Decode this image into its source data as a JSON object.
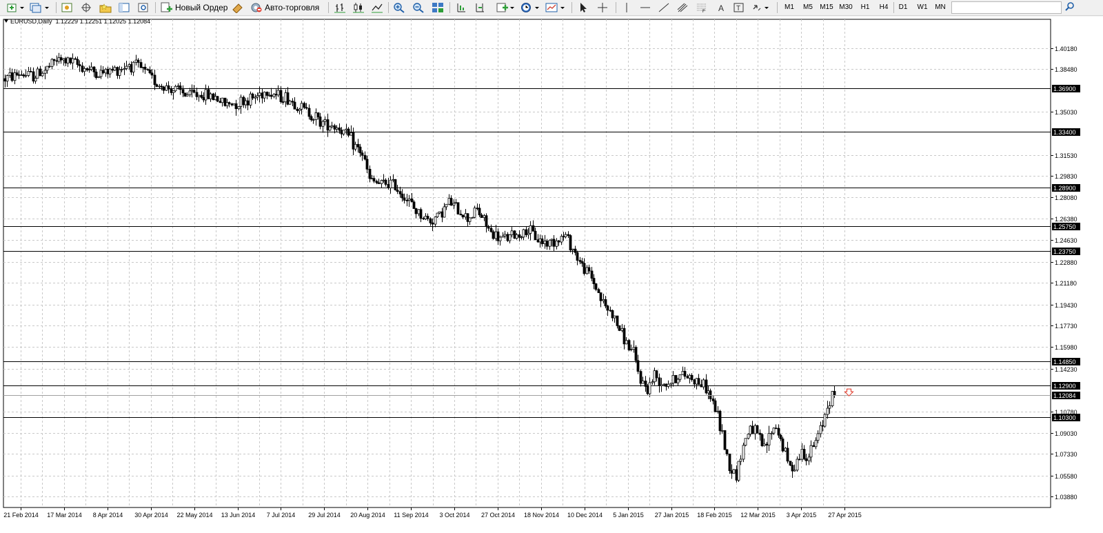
{
  "toolbar": {
    "new_order_label": "Новый Ордер",
    "auto_trading_label": "Авто-торговля",
    "timeframes": [
      "M1",
      "M5",
      "M15",
      "M30",
      "H1",
      "H4",
      "D1",
      "W1",
      "MN"
    ],
    "search_placeholder": ""
  },
  "chart_header": {
    "symbol": "EURUSD,Daily",
    "ohlc": "1.12229 1.12251 1.12025 1.12084"
  },
  "chart_data": {
    "type": "candlestick",
    "symbol": "EURUSD",
    "timeframe": "Daily",
    "ylim": [
      1.03,
      1.425
    ],
    "price_ticks": [
      1.4018,
      1.3848,
      1.3503,
      1.3153,
      1.2983,
      1.2808,
      1.2638,
      1.2463,
      1.2288,
      1.2118,
      1.1943,
      1.1773,
      1.1598,
      1.1423,
      1.1078,
      1.0903,
      1.0733,
      1.0558,
      1.0388
    ],
    "price_tick_labels": [
      "1.40180",
      "1.38480",
      "1.35030",
      "1.31530",
      "1.29830",
      "1.28080",
      "1.26380",
      "1.24630",
      "1.22880",
      "1.21180",
      "1.19430",
      "1.17730",
      "1.15980",
      "1.14230",
      "1.10780",
      "1.09030",
      "1.07330",
      "1.05580",
      "1.03880"
    ],
    "date_labels": [
      "21 Feb 2014",
      "17 Mar 2014",
      "8 Apr 2014",
      "30 Apr 2014",
      "22 May 2014",
      "13 Jun 2014",
      "7 Jul 2014",
      "29 Jul 2014",
      "20 Aug 2014",
      "11 Sep 2014",
      "3 Oct 2014",
      "27 Oct 2014",
      "18 Nov 2014",
      "10 Dec 2014",
      "5 Jan 2015",
      "27 Jan 2015",
      "18 Feb 2015",
      "12 Mar 2015",
      "3 Apr 2015",
      "27 Apr 2015"
    ],
    "horizontal_levels": [
      1.369,
      1.334,
      1.289,
      1.2575,
      1.2375,
      1.1485,
      1.129,
      1.103
    ],
    "horizontal_level_labels": [
      "1.36900",
      "1.33400",
      "1.28900",
      "1.25750",
      "1.23750",
      "1.14850",
      "1.12900",
      "1.10300"
    ],
    "current_price": 1.12084,
    "current_price_label": "1.12084",
    "price_path": [
      [
        0,
        1.377
      ],
      [
        6,
        1.381
      ],
      [
        12,
        1.379
      ],
      [
        18,
        1.385
      ],
      [
        22,
        1.392
      ],
      [
        27,
        1.391
      ],
      [
        30,
        1.389
      ],
      [
        35,
        1.385
      ],
      [
        40,
        1.381
      ],
      [
        45,
        1.383
      ],
      [
        50,
        1.386
      ],
      [
        53,
        1.389
      ],
      [
        57,
        1.386
      ],
      [
        60,
        1.382
      ],
      [
        66,
        1.372
      ],
      [
        72,
        1.368
      ],
      [
        78,
        1.364
      ],
      [
        84,
        1.364
      ],
      [
        90,
        1.362
      ],
      [
        94,
        1.356
      ],
      [
        100,
        1.358
      ],
      [
        106,
        1.361
      ],
      [
        110,
        1.366
      ],
      [
        113,
        1.367
      ],
      [
        117,
        1.363
      ],
      [
        120,
        1.362
      ],
      [
        124,
        1.357
      ],
      [
        128,
        1.352
      ],
      [
        132,
        1.347
      ],
      [
        136,
        1.341
      ],
      [
        140,
        1.34
      ],
      [
        143,
        1.337
      ],
      [
        147,
        1.33
      ],
      [
        150,
        1.322
      ],
      [
        153,
        1.316
      ],
      [
        156,
        1.295
      ],
      [
        161,
        1.291
      ],
      [
        164,
        1.293
      ],
      [
        167,
        1.29
      ],
      [
        171,
        1.282
      ],
      [
        175,
        1.272
      ],
      [
        179,
        1.265
      ],
      [
        182,
        1.262
      ],
      [
        186,
        1.267
      ],
      [
        190,
        1.277
      ],
      [
        194,
        1.271
      ],
      [
        198,
        1.264
      ],
      [
        202,
        1.271
      ],
      [
        205,
        1.262
      ],
      [
        208,
        1.252
      ],
      [
        212,
        1.247
      ],
      [
        216,
        1.249
      ],
      [
        220,
        1.251
      ],
      [
        224,
        1.254
      ],
      [
        228,
        1.247
      ],
      [
        232,
        1.244
      ],
      [
        236,
        1.247
      ],
      [
        240,
        1.25
      ],
      [
        244,
        1.236
      ],
      [
        247,
        1.225
      ],
      [
        250,
        1.219
      ],
      [
        253,
        1.208
      ],
      [
        256,
        1.195
      ],
      [
        260,
        1.186
      ],
      [
        263,
        1.174
      ],
      [
        266,
        1.163
      ],
      [
        269,
        1.154
      ],
      [
        272,
        1.133
      ],
      [
        275,
        1.126
      ],
      [
        278,
        1.137
      ],
      [
        281,
        1.132
      ],
      [
        284,
        1.131
      ],
      [
        288,
        1.136
      ],
      [
        292,
        1.137
      ],
      [
        296,
        1.133
      ],
      [
        300,
        1.127
      ],
      [
        304,
        1.11
      ],
      [
        307,
        1.089
      ],
      [
        310,
        1.063
      ],
      [
        313,
        1.057
      ],
      [
        316,
        1.08
      ],
      [
        319,
        1.096
      ],
      [
        322,
        1.088
      ],
      [
        325,
        1.077
      ],
      [
        328,
        1.092
      ],
      [
        330,
        1.096
      ],
      [
        333,
        1.079
      ],
      [
        336,
        1.062
      ],
      [
        338,
        1.065
      ],
      [
        341,
        1.075
      ],
      [
        344,
        1.072
      ],
      [
        347,
        1.083
      ],
      [
        350,
        1.098
      ],
      [
        352,
        1.114
      ],
      [
        354,
        1.121
      ],
      [
        355,
        1.1208
      ]
    ]
  }
}
